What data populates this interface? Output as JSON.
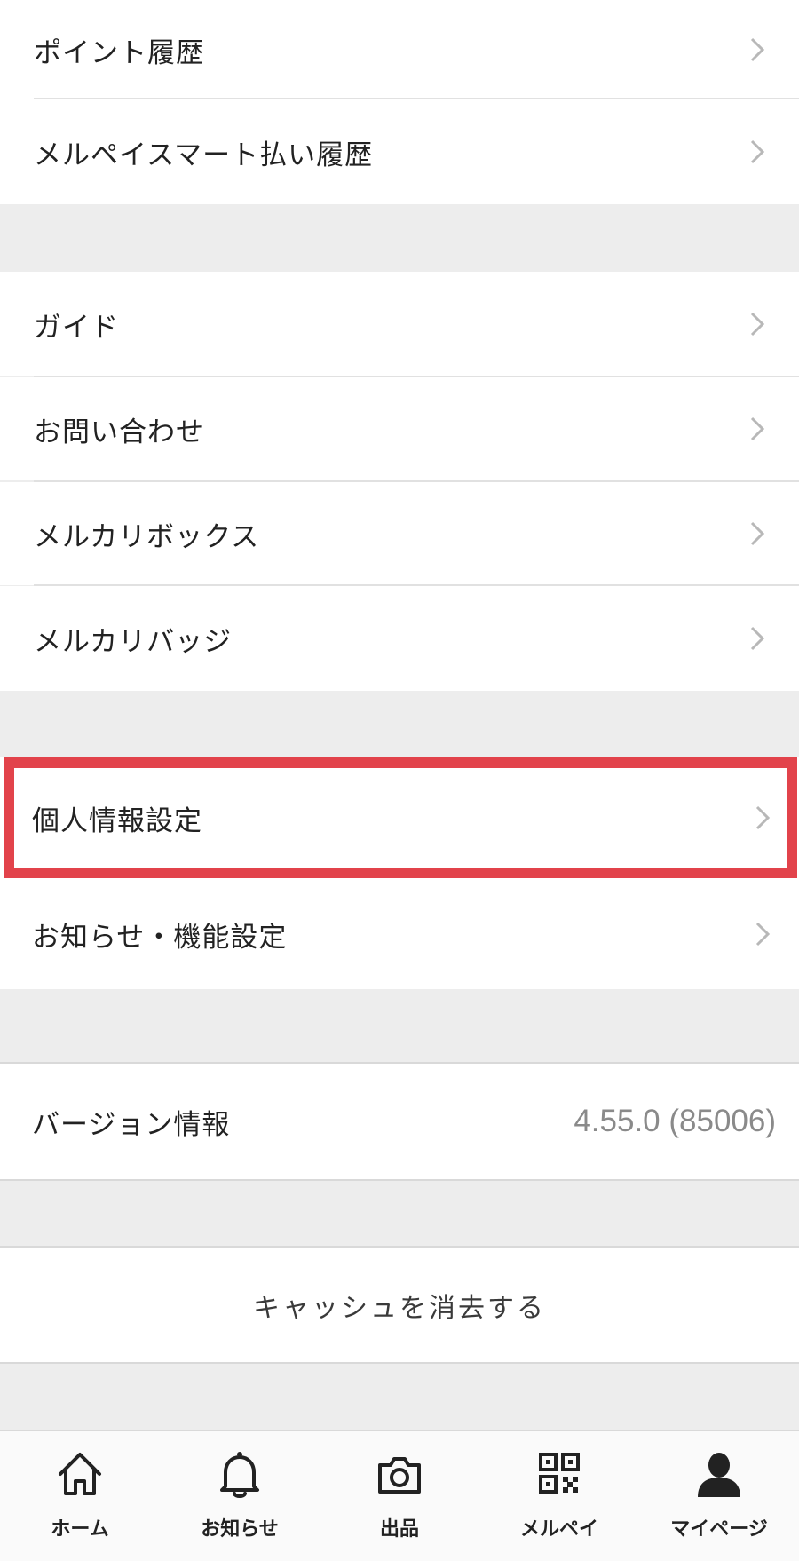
{
  "group1": [
    {
      "label": "ポイント履歴"
    },
    {
      "label": "メルペイスマート払い履歴"
    }
  ],
  "group2": [
    {
      "label": "ガイド"
    },
    {
      "label": "お問い合わせ"
    },
    {
      "label": "メルカリボックス"
    },
    {
      "label": "メルカリバッジ"
    }
  ],
  "group3": [
    {
      "label": "個人情報設定"
    },
    {
      "label": "お知らせ・機能設定"
    }
  ],
  "version": {
    "label": "バージョン情報",
    "value": "4.55.0 (85006)"
  },
  "cache": {
    "label": "キャッシュを消去する"
  },
  "highlight_color": "#e2434b",
  "tabbar": {
    "tabs": [
      {
        "label": "ホーム",
        "icon": "home-icon"
      },
      {
        "label": "お知らせ",
        "icon": "bell-icon"
      },
      {
        "label": "出品",
        "icon": "camera-icon"
      },
      {
        "label": "メルペイ",
        "icon": "qr-code-icon"
      },
      {
        "label": "マイページ",
        "icon": "person-icon"
      }
    ]
  }
}
